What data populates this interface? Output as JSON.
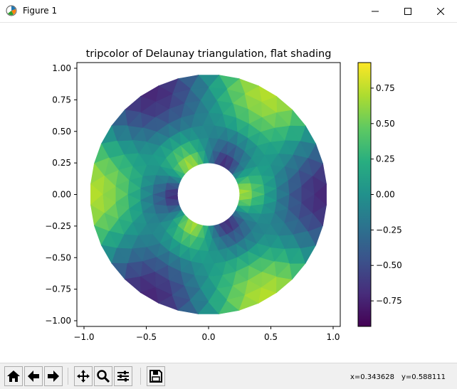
{
  "window": {
    "title": "Figure 1"
  },
  "chart_data": {
    "type": "heatmap",
    "title": "tripcolor of Delaunay triangulation, flat shading",
    "xlabel": "",
    "ylabel": "",
    "xlim": [
      -1.0,
      1.0
    ],
    "ylim": [
      -1.0,
      1.0
    ],
    "x_ticks": [
      "−1.0",
      "−0.5",
      "0.0",
      "0.5",
      "1.0"
    ],
    "y_ticks": [
      "1.00",
      "0.75",
      "0.50",
      "0.25",
      "0.00",
      "−0.25",
      "−0.50",
      "−0.75",
      "−1.00"
    ],
    "inner_radius": 0.25,
    "outer_radius": 0.95,
    "n_radii": 8,
    "n_angles": 36,
    "colorbar": {
      "colormap": "viridis",
      "range": [
        -0.93,
        0.93
      ],
      "ticks": [
        "0.75",
        "0.50",
        "0.25",
        "0.00",
        "−0.25",
        "−0.50",
        "−0.75"
      ]
    }
  },
  "toolbar": {
    "buttons": [
      "home-icon",
      "back-icon",
      "forward-icon",
      "pan-icon",
      "zoom-icon",
      "subplots-icon",
      "save-icon"
    ]
  },
  "status": {
    "x_readout": "x=0.343628",
    "y_readout": "y=0.588111"
  }
}
